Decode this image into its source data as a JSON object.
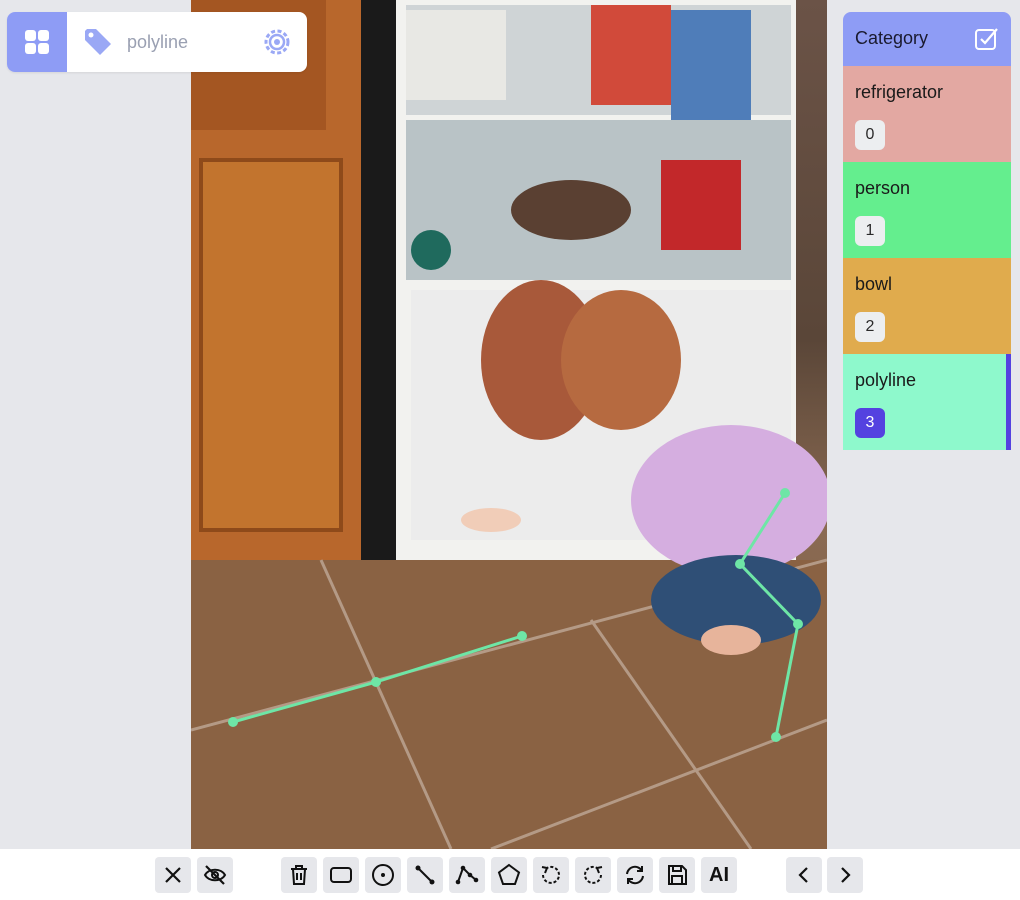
{
  "topbar": {
    "label": "polyline",
    "icons": [
      "apps-icon",
      "tag-icon",
      "gear-icon"
    ]
  },
  "panel": {
    "title": "Category",
    "categories": [
      {
        "name": "refrigerator",
        "index": "0",
        "color": "#e3a8a2"
      },
      {
        "name": "person",
        "index": "1",
        "color": "#64ee8e"
      },
      {
        "name": "bowl",
        "index": "2",
        "color": "#e0ab4d"
      },
      {
        "name": "polyline",
        "index": "3",
        "color": "#8ef9cc",
        "active": true
      }
    ]
  },
  "toolbar": {
    "buttons": [
      "close-icon",
      "eye-off-icon",
      "trash-icon",
      "rectangle-icon",
      "point-icon",
      "line-icon",
      "polyline-icon",
      "polygon-icon",
      "undo-icon",
      "redo-icon",
      "refresh-icon",
      "save-icon",
      "ai-icon",
      "chevron-left-icon",
      "chevron-right-icon"
    ],
    "ai_label": "AI"
  },
  "colors": {
    "accent": "#8e9cf5",
    "active": "#5442e0",
    "polyline": "#6ee6a6"
  }
}
